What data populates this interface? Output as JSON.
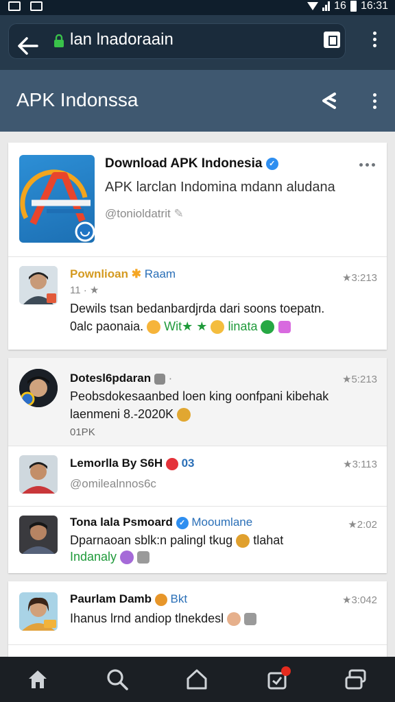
{
  "status_bar": {
    "time": "16:31",
    "network": "16"
  },
  "browser": {
    "url": "lan lnadoraain"
  },
  "app_bar": {
    "title": "APK Indonssa"
  },
  "profile": {
    "name": "Download APK Indonesia",
    "description": "APK  larclan Indomina mdann aludana",
    "handle": "@tonioldatrit"
  },
  "feed": [
    {
      "name_part1": "Pownlioan",
      "name_part2": "Raam",
      "sub": "11 · ★",
      "time": "★3:213",
      "text_line1": "Dewils tsan bedanbardjrda dari soons toepatn.",
      "text_line2_a": "0alc paonaia.",
      "text_line2_b": "Wit",
      "text_line2_c": "linata"
    },
    {
      "name": "Dotesl6pdaran",
      "time": "★5:213",
      "text_line1": "Peobsdokesaanbed loen king oonfpani kibehak",
      "text_line2": "laenmeni 8.-2020K",
      "text_line3": "01PK"
    },
    {
      "name": "Lemorlla By S6H",
      "name_suffix": "03",
      "time": "★3:113",
      "handle": "@omilealnnos6c"
    },
    {
      "name": "Tona lala Psmoard",
      "name_suffix": "Mooumlane",
      "time": "★2:02",
      "text_line1": "Dparnaoan sblk:n palingl tkug",
      "text_line1_b": "tlahat",
      "text_line2": "Indanaly"
    },
    {
      "name": "Paurlam Damb",
      "name_suffix": "Bkt",
      "time": "★3:042",
      "text_line1": "Ihanus lrnd andiop tlnekdesl"
    }
  ],
  "icons": {
    "back": "arrow-left",
    "lock": "lock",
    "tabs": "tab-switch",
    "menu": "kebab",
    "share": "share",
    "nav": [
      "home",
      "search",
      "home-outline",
      "notifications",
      "tabs"
    ]
  },
  "colors": {
    "browser_bar": "#263a4c",
    "app_bar": "#3f5870",
    "verified": "#2e8ef0",
    "notif": "#e52b1e"
  }
}
